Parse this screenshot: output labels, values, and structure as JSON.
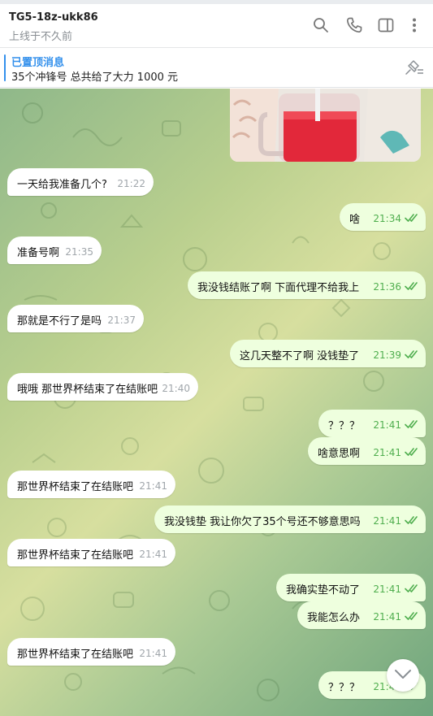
{
  "header": {
    "title": "TG5-18z-ukk86",
    "status": "上线于不久前",
    "icons": [
      "search-icon",
      "phone-icon",
      "sidebar-toggle-icon",
      "more-vertical-icon"
    ]
  },
  "pinned": {
    "title": "已置顶消息",
    "text": "35个冲锋号 总共给了大力 1000  元",
    "icon": "pin-list-icon"
  },
  "messages": [
    {
      "dir": "in",
      "text": "一天给我准备几个?",
      "time": "21:22"
    },
    {
      "dir": "out",
      "text": "啥",
      "time": "21:34"
    },
    {
      "dir": "in",
      "text": "准备号啊",
      "time": "21:35"
    },
    {
      "dir": "out",
      "text": "我没钱结账了啊  下面代理不给我上",
      "time": "21:36"
    },
    {
      "dir": "in",
      "text": "那就是不行了是吗",
      "time": "21:37"
    },
    {
      "dir": "out",
      "text": "这几天整不了啊  没钱垫了",
      "time": "21:39"
    },
    {
      "dir": "in",
      "text": "哦哦 那世界杯结束了在结账吧",
      "time": "21:40"
    },
    {
      "dir": "out",
      "text": "？？？",
      "time": "21:41"
    },
    {
      "dir": "out",
      "text": "啥意思啊",
      "time": "21:41"
    },
    {
      "dir": "in",
      "text": "那世界杯结束了在结账吧",
      "time": "21:41"
    },
    {
      "dir": "out",
      "text": "我没钱垫  我让你欠了35个号还不够意思吗",
      "time": "21:41"
    },
    {
      "dir": "in",
      "text": "那世界杯结束了在结账吧",
      "time": "21:41"
    },
    {
      "dir": "out",
      "text": "我确实垫不动了",
      "time": "21:41"
    },
    {
      "dir": "out",
      "text": "我能怎么办",
      "time": "21:41"
    },
    {
      "dir": "in",
      "text": "那世界杯结束了在结账吧",
      "time": "21:41"
    },
    {
      "dir": "out",
      "text": "？？？",
      "time": "21:42"
    }
  ],
  "colors": {
    "accent": "#3390ec",
    "outgoing_bubble": "#eeffde",
    "incoming_bubble": "#ffffff",
    "read_check": "#4fae4e"
  }
}
